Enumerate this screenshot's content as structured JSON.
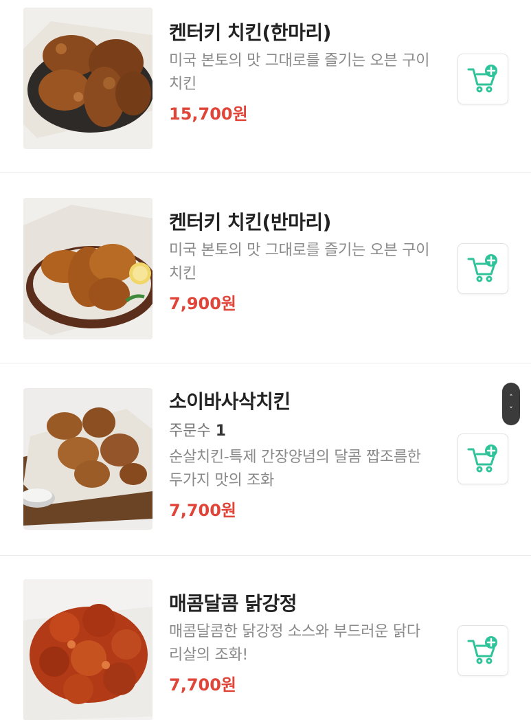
{
  "menu": {
    "items": [
      {
        "title": "켄터키 치킨(한마리)",
        "description": "미국 본토의 맛 그대로를 즐기는 오븐 구이 치킨",
        "price": "15,700원",
        "image_icon": "fried-chicken-whole-image"
      },
      {
        "title": "켄터키 치킨(반마리)",
        "description": "미국 본토의 맛 그대로를 즐기는 오븐 구이 치킨",
        "price": "7,900원",
        "image_icon": "fried-chicken-half-image"
      },
      {
        "title": "소이바사삭치킨",
        "orders_label": "주문수",
        "orders_count": "1",
        "description": "순살치킨-특제 간장양념의 달콤 짭조름한 두가지 맛의 조화",
        "price": "7,700원",
        "image_icon": "soy-crispy-chicken-image"
      },
      {
        "title": "매콤달콤 닭강정",
        "description": "매콤달콤한 닭강정 소스와 부드러운 닭다리살의 조화!",
        "price": "7,700원",
        "image_icon": "dakgangjeong-image"
      }
    ]
  },
  "icons": {
    "cart_add": "cart-add-icon",
    "scroll_up": "chevron-up-icon",
    "scroll_down": "chevron-down-icon"
  },
  "colors": {
    "price": "#e0453a",
    "cart_icon": "#2fc39a",
    "divider": "#ececec"
  }
}
